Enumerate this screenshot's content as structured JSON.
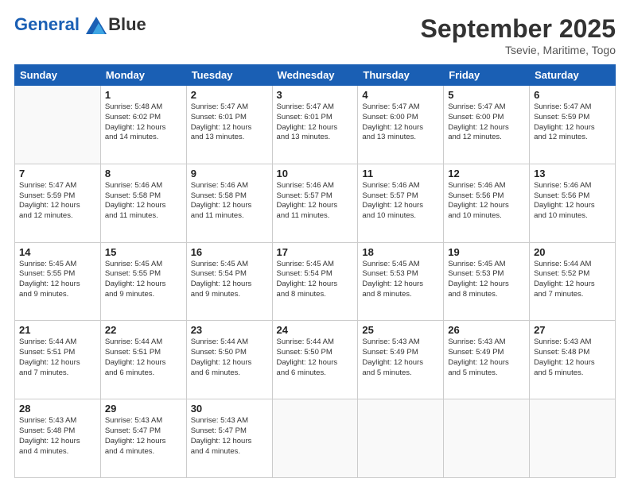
{
  "logo": {
    "line1": "General",
    "line2": "Blue"
  },
  "title": "September 2025",
  "subtitle": "Tsevie, Maritime, Togo",
  "weekdays": [
    "Sunday",
    "Monday",
    "Tuesday",
    "Wednesday",
    "Thursday",
    "Friday",
    "Saturday"
  ],
  "weeks": [
    [
      {
        "day": null
      },
      {
        "day": 1,
        "sunrise": "5:48 AM",
        "sunset": "6:02 PM",
        "daylight": "12 hours and 14 minutes."
      },
      {
        "day": 2,
        "sunrise": "5:47 AM",
        "sunset": "6:01 PM",
        "daylight": "12 hours and 13 minutes."
      },
      {
        "day": 3,
        "sunrise": "5:47 AM",
        "sunset": "6:01 PM",
        "daylight": "12 hours and 13 minutes."
      },
      {
        "day": 4,
        "sunrise": "5:47 AM",
        "sunset": "6:00 PM",
        "daylight": "12 hours and 13 minutes."
      },
      {
        "day": 5,
        "sunrise": "5:47 AM",
        "sunset": "6:00 PM",
        "daylight": "12 hours and 12 minutes."
      },
      {
        "day": 6,
        "sunrise": "5:47 AM",
        "sunset": "5:59 PM",
        "daylight": "12 hours and 12 minutes."
      }
    ],
    [
      {
        "day": 7,
        "sunrise": "5:47 AM",
        "sunset": "5:59 PM",
        "daylight": "12 hours and 12 minutes."
      },
      {
        "day": 8,
        "sunrise": "5:46 AM",
        "sunset": "5:58 PM",
        "daylight": "12 hours and 11 minutes."
      },
      {
        "day": 9,
        "sunrise": "5:46 AM",
        "sunset": "5:58 PM",
        "daylight": "12 hours and 11 minutes."
      },
      {
        "day": 10,
        "sunrise": "5:46 AM",
        "sunset": "5:57 PM",
        "daylight": "12 hours and 11 minutes."
      },
      {
        "day": 11,
        "sunrise": "5:46 AM",
        "sunset": "5:57 PM",
        "daylight": "12 hours and 10 minutes."
      },
      {
        "day": 12,
        "sunrise": "5:46 AM",
        "sunset": "5:56 PM",
        "daylight": "12 hours and 10 minutes."
      },
      {
        "day": 13,
        "sunrise": "5:46 AM",
        "sunset": "5:56 PM",
        "daylight": "12 hours and 10 minutes."
      }
    ],
    [
      {
        "day": 14,
        "sunrise": "5:45 AM",
        "sunset": "5:55 PM",
        "daylight": "12 hours and 9 minutes."
      },
      {
        "day": 15,
        "sunrise": "5:45 AM",
        "sunset": "5:55 PM",
        "daylight": "12 hours and 9 minutes."
      },
      {
        "day": 16,
        "sunrise": "5:45 AM",
        "sunset": "5:54 PM",
        "daylight": "12 hours and 9 minutes."
      },
      {
        "day": 17,
        "sunrise": "5:45 AM",
        "sunset": "5:54 PM",
        "daylight": "12 hours and 8 minutes."
      },
      {
        "day": 18,
        "sunrise": "5:45 AM",
        "sunset": "5:53 PM",
        "daylight": "12 hours and 8 minutes."
      },
      {
        "day": 19,
        "sunrise": "5:45 AM",
        "sunset": "5:53 PM",
        "daylight": "12 hours and 8 minutes."
      },
      {
        "day": 20,
        "sunrise": "5:44 AM",
        "sunset": "5:52 PM",
        "daylight": "12 hours and 7 minutes."
      }
    ],
    [
      {
        "day": 21,
        "sunrise": "5:44 AM",
        "sunset": "5:51 PM",
        "daylight": "12 hours and 7 minutes."
      },
      {
        "day": 22,
        "sunrise": "5:44 AM",
        "sunset": "5:51 PM",
        "daylight": "12 hours and 6 minutes."
      },
      {
        "day": 23,
        "sunrise": "5:44 AM",
        "sunset": "5:50 PM",
        "daylight": "12 hours and 6 minutes."
      },
      {
        "day": 24,
        "sunrise": "5:44 AM",
        "sunset": "5:50 PM",
        "daylight": "12 hours and 6 minutes."
      },
      {
        "day": 25,
        "sunrise": "5:43 AM",
        "sunset": "5:49 PM",
        "daylight": "12 hours and 5 minutes."
      },
      {
        "day": 26,
        "sunrise": "5:43 AM",
        "sunset": "5:49 PM",
        "daylight": "12 hours and 5 minutes."
      },
      {
        "day": 27,
        "sunrise": "5:43 AM",
        "sunset": "5:48 PM",
        "daylight": "12 hours and 5 minutes."
      }
    ],
    [
      {
        "day": 28,
        "sunrise": "5:43 AM",
        "sunset": "5:48 PM",
        "daylight": "12 hours and 4 minutes."
      },
      {
        "day": 29,
        "sunrise": "5:43 AM",
        "sunset": "5:47 PM",
        "daylight": "12 hours and 4 minutes."
      },
      {
        "day": 30,
        "sunrise": "5:43 AM",
        "sunset": "5:47 PM",
        "daylight": "12 hours and 4 minutes."
      },
      {
        "day": null
      },
      {
        "day": null
      },
      {
        "day": null
      },
      {
        "day": null
      }
    ]
  ],
  "labels": {
    "sunrise_prefix": "Sunrise: ",
    "sunset_prefix": "Sunset: ",
    "daylight_prefix": "Daylight: "
  }
}
